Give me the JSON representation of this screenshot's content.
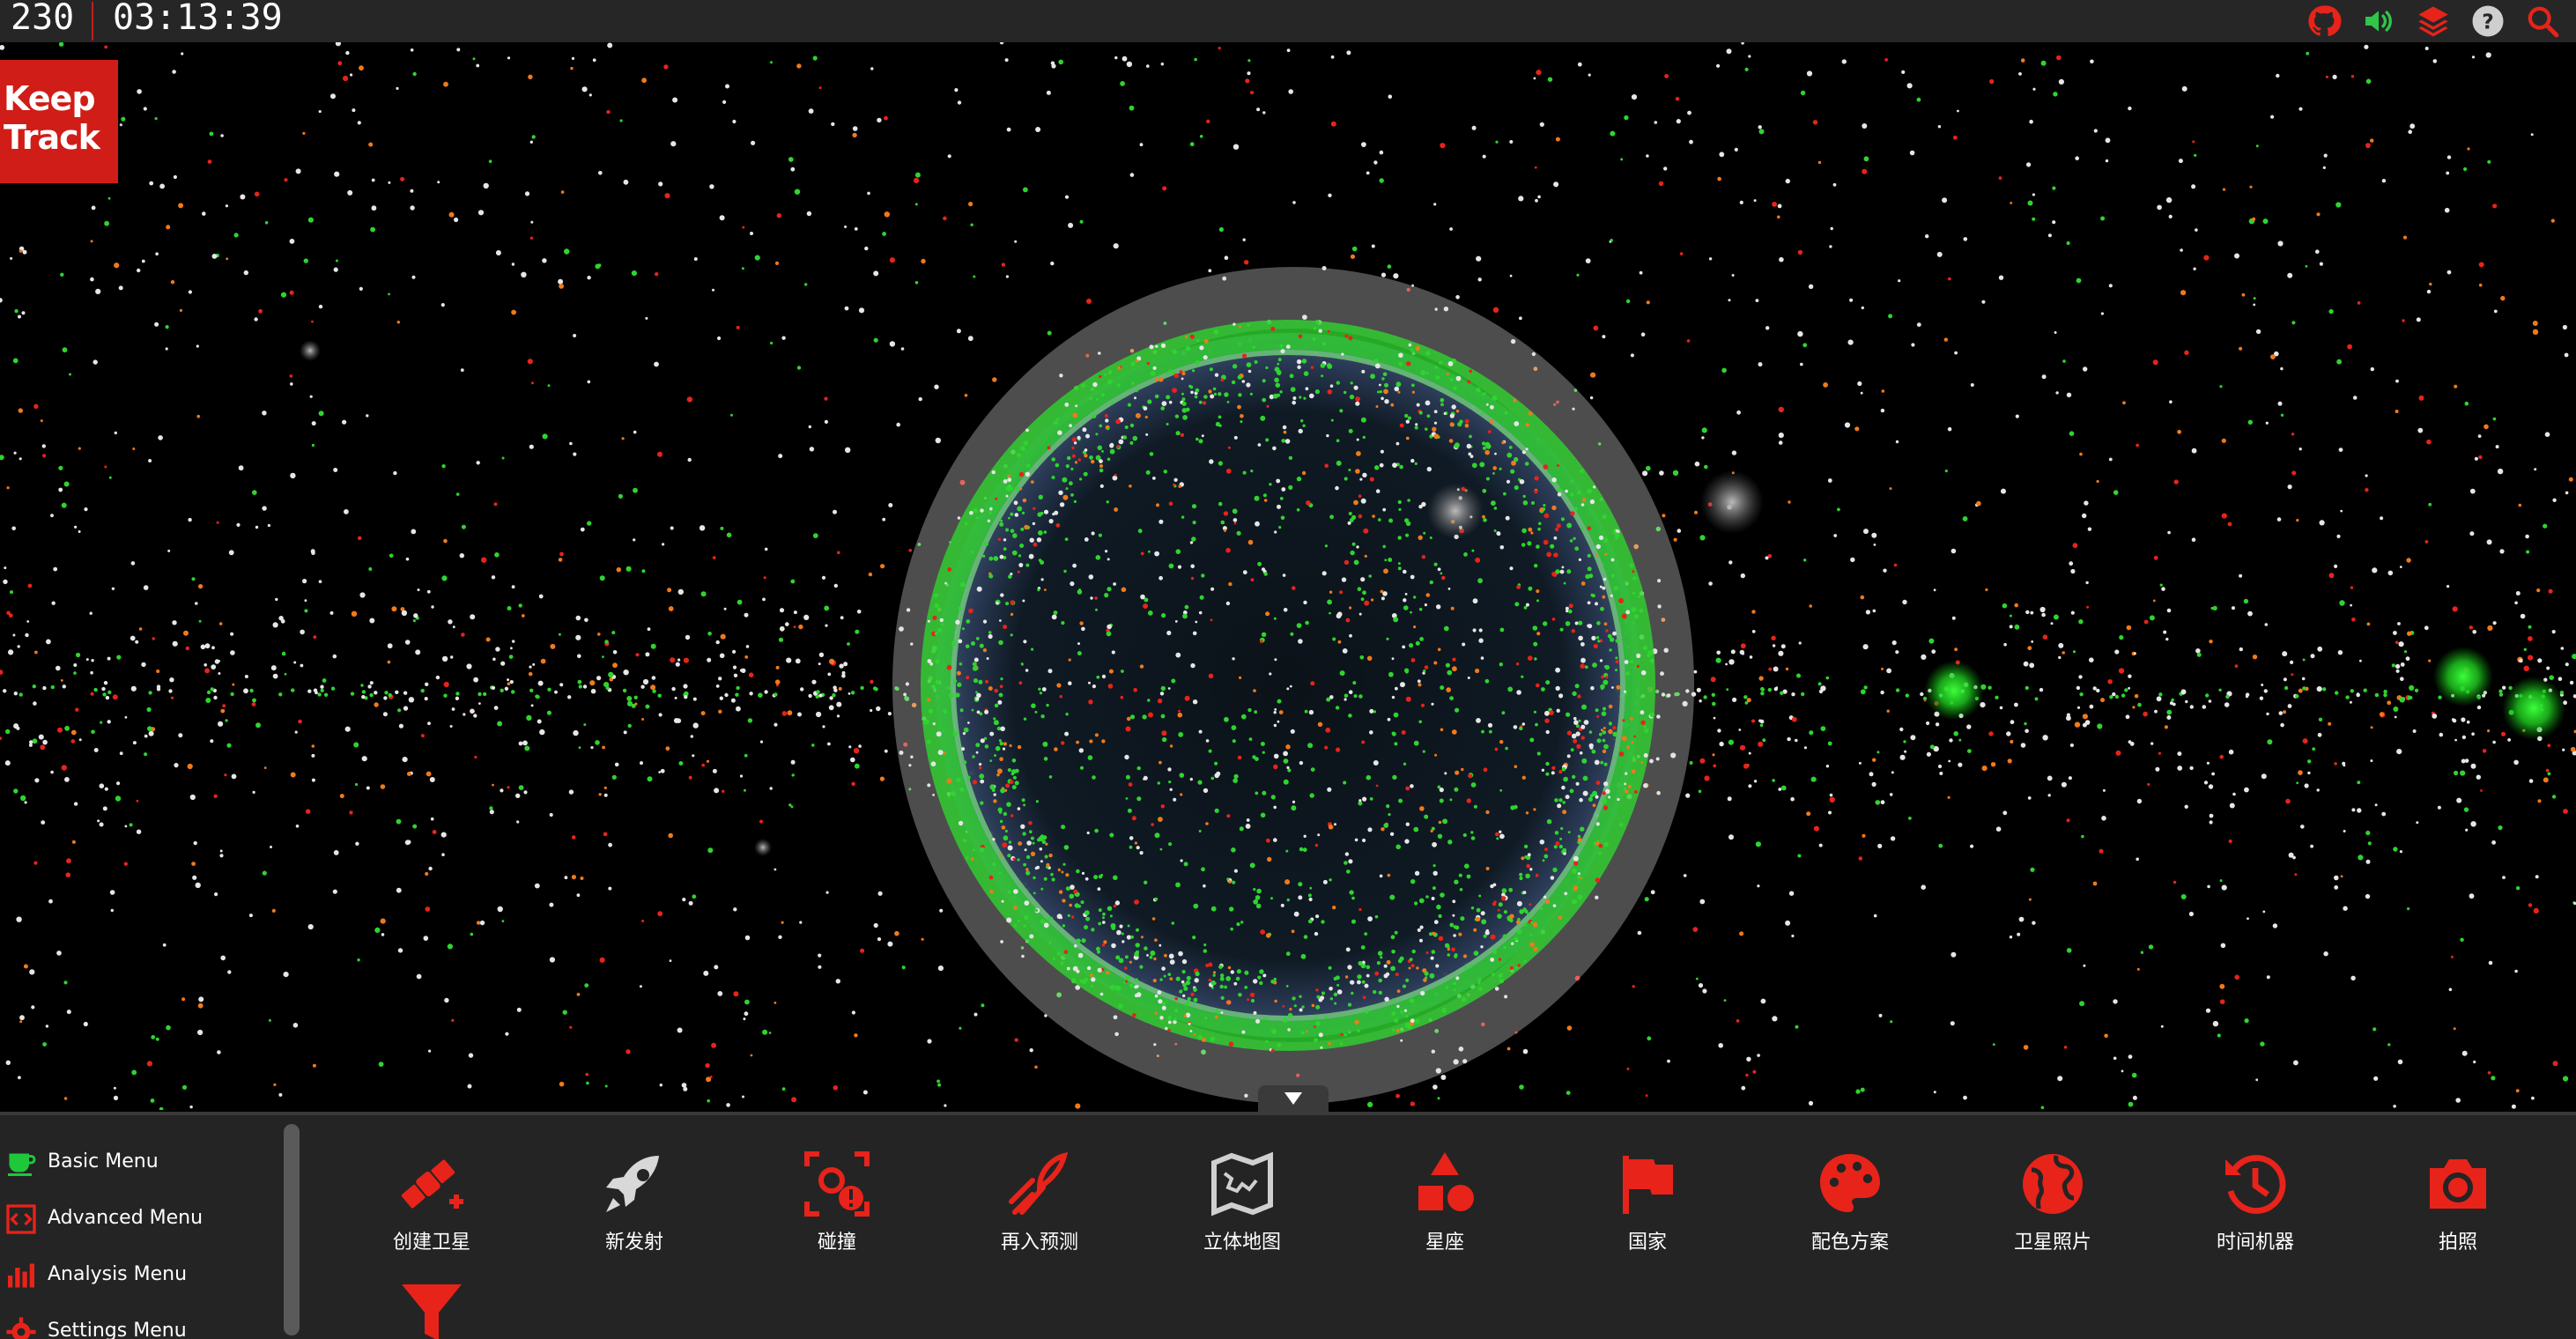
{
  "topbar": {
    "fps": "230",
    "clock": "03:13:39",
    "icons": [
      "github-icon",
      "sound-icon",
      "layers-icon",
      "help-icon",
      "search-icon"
    ]
  },
  "logo": {
    "line1": "Keep",
    "line2": "Track"
  },
  "menus": [
    {
      "label": "Basic Menu",
      "icon": "coffee-cup-icon"
    },
    {
      "label": "Advanced Menu",
      "icon": "code-brackets-icon"
    },
    {
      "label": "Analysis Menu",
      "icon": "bar-chart-icon"
    },
    {
      "label": "Settings Menu",
      "icon": "gear-icon"
    }
  ],
  "tools": [
    {
      "label": "创建卫星",
      "icon": "satellite-add-icon"
    },
    {
      "label": "新发射",
      "icon": "rocket-icon"
    },
    {
      "label": "碰撞",
      "icon": "collision-icon"
    },
    {
      "label": "再入预测",
      "icon": "reentry-icon"
    },
    {
      "label": "立体地图",
      "icon": "map-icon"
    },
    {
      "label": "星座",
      "icon": "shapes-icon"
    },
    {
      "label": "国家",
      "icon": "flag-icon"
    },
    {
      "label": "配色方案",
      "icon": "palette-icon"
    },
    {
      "label": "卫星照片",
      "icon": "globe-icon"
    },
    {
      "label": "时间机器",
      "icon": "history-icon"
    },
    {
      "label": "拍照",
      "icon": "camera-icon"
    },
    {
      "label": "",
      "icon": "filter-icon"
    }
  ],
  "colors": {
    "accent": "#e8231a",
    "topbar": "#262626",
    "bottom": "#242424",
    "logo": "#d01d17",
    "menu_icon_basic": "#1ec83a"
  }
}
